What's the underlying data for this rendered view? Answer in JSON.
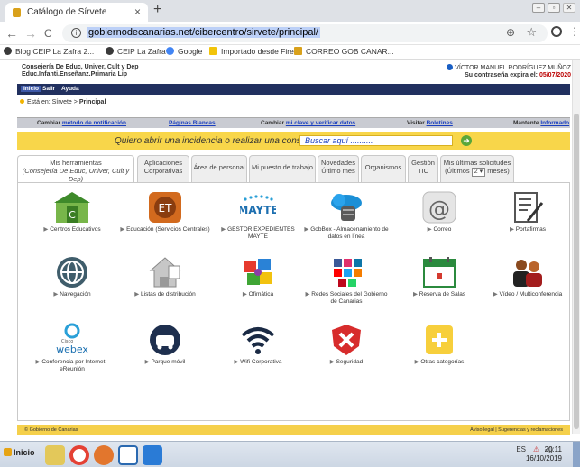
{
  "browser": {
    "tab_title": "Catálogo de Sírvete",
    "tab_close": "×",
    "new_tab": "+",
    "url": "gobiernodecanarias.net/cibercentro/sirvete/principal/",
    "back": "←",
    "forward": "→",
    "reload": "C",
    "menu": "⋮",
    "info": "i",
    "zoom": "⊕",
    "star": "☆",
    "win_min": "–",
    "win_restore": "▫",
    "win_close": "✕",
    "bookmarks": [
      {
        "label": "Blog CEIP La Zafra 2...",
        "color": "#3a3a3a"
      },
      {
        "label": "CEIP La Zafra",
        "color": "#3a3a3a"
      },
      {
        "label": "Google",
        "color": "#4285f4"
      },
      {
        "label": "Importado desde Fire...",
        "color": "#f2c40a"
      },
      {
        "label": "CORREO GOB CANAR...",
        "color": "#d9a11b"
      }
    ]
  },
  "header": {
    "org_line1": "Consejería De Educ, Univer, Cult y Dep",
    "org_line2": "Educ.Infanti.Enseñanz.Primaria Lip",
    "user_name": "VÍCTOR MANUEL RODRÍGUEZ MUÑOZ",
    "pw_label": "Su contraseña expira el:",
    "pw_date": "05/07/2020",
    "menu": [
      "Inicio",
      "Salir",
      "Ayuda"
    ],
    "breadcrumb": {
      "prefix": "Está en:",
      "path": "Sírvete",
      "sep": ">",
      "current": "Principal"
    }
  },
  "subbar": [
    {
      "text": "Cambiar ",
      "link": "método de notificación"
    },
    {
      "text": "",
      "link": "Páginas Blancas"
    },
    {
      "text": "Cambiar ",
      "link": "mi clave y verificar datos"
    },
    {
      "text": "Visitar ",
      "link": "Boletines"
    },
    {
      "text": "Mantente ",
      "link": "Informado"
    }
  ],
  "incident": {
    "question": "Quiero abrir una incidencia o realizar una consulta sobre",
    "placeholder": "Buscar aquí ..........",
    "go": "➜"
  },
  "tabs": [
    {
      "line1": "Mis herramientas",
      "line2": "(Consejería De Educ, Univer, Cult y Dep)"
    },
    {
      "line1": "Aplicaciones",
      "line2": "Corporativas"
    },
    {
      "line1": "Área de personal",
      "line2": ""
    },
    {
      "line1": "Mi puesto de trabajo",
      "line2": ""
    },
    {
      "line1": "Novedades",
      "line2": "Último mes"
    },
    {
      "line1": "Organismos",
      "line2": ""
    },
    {
      "line1": "Gestión",
      "line2": "TIC"
    },
    {
      "line1": "Mis últimas solicitudes",
      "pre": "(Últimos",
      "sel": "2 ▾",
      "post": "meses)"
    }
  ],
  "tools": [
    {
      "label": "Centros Educativos",
      "icon": "school-icon"
    },
    {
      "label": "Educación (Servicios Centrales)",
      "icon": "building-icon"
    },
    {
      "label": "GESTOR EXPEDIENTES MAYTE",
      "icon": "mayte-logo-icon"
    },
    {
      "label": "GobBox - Almacenamiento de datos en línea",
      "icon": "cloud-storage-icon"
    },
    {
      "label": "Correo",
      "icon": "at-icon"
    },
    {
      "label": "Portafirmas",
      "icon": "sign-document-icon"
    },
    {
      "label": "Navegación",
      "icon": "globe-icon"
    },
    {
      "label": "Listas de distribución",
      "icon": "house-list-icon"
    },
    {
      "label": "Ofimática",
      "icon": "puzzle-icon"
    },
    {
      "label": "Redes Sociales del Gobierno de Canarias",
      "icon": "social-networks-icon"
    },
    {
      "label": "Reserva de Salas",
      "icon": "calendar-icon"
    },
    {
      "label": "Vídeo / Multiconferencia",
      "icon": "people-icon"
    },
    {
      "label": "Conferencia por Internet - eReunión",
      "icon": "webex-icon"
    },
    {
      "label": "Parque móvil",
      "icon": "car-icon"
    },
    {
      "label": "Wifi Corporativa",
      "icon": "wifi-icon"
    },
    {
      "label": "Seguridad",
      "icon": "security-shield-icon"
    },
    {
      "label": "Otras categorías",
      "icon": "plus-icon"
    }
  ],
  "webex": {
    "small": "Cisco",
    "big": "webex"
  },
  "mayte": {
    "text": "MAYTE"
  },
  "footer": {
    "left": "© Gobierno de Canarias",
    "right": "Aviso legal  |  Sugerencias y reclamaciones"
  },
  "taskbar": {
    "start": "Inicio",
    "lang": "ES",
    "time": "20:11",
    "date": "16/10/2019"
  }
}
